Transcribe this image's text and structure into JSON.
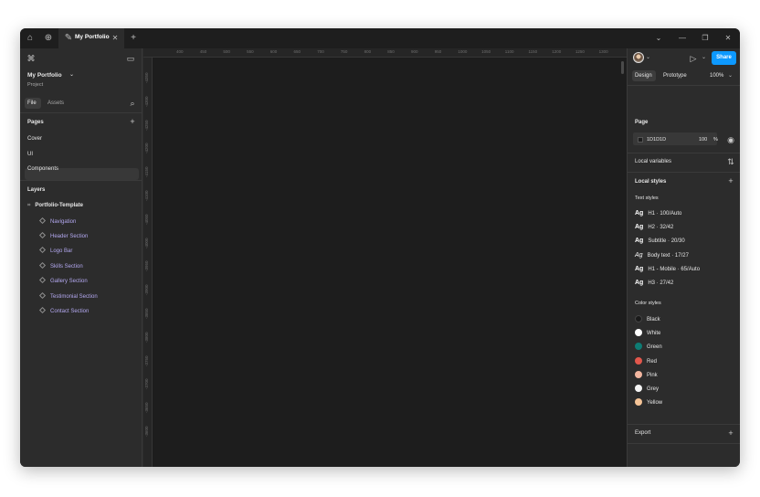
{
  "titlebar": {
    "tab_title": "My Portfolio",
    "icons": [
      "home-icon",
      "globe-icon",
      "file-icon",
      "close-icon",
      "plus-icon"
    ]
  },
  "left": {
    "file_name": "My Portfolio",
    "file_subtitle": "Project",
    "tabs": [
      "File",
      "Assets"
    ],
    "pages_heading": "Pages",
    "pages": [
      "Cover",
      "UI",
      "Components"
    ],
    "layers_heading": "Layers",
    "root_layer": "Portfolio-Template",
    "layers": [
      "Navigation",
      "Header Section",
      "Logo Bar",
      "Skills Section",
      "Gallery Section",
      "Testimonial Section",
      "Contact Section"
    ]
  },
  "ruler": {
    "top": [
      "400",
      "450",
      "500",
      "550",
      "600",
      "650",
      "700",
      "750",
      "800",
      "850",
      "900",
      "950",
      "1000",
      "1050",
      "1100",
      "1150",
      "1200",
      "1250",
      "1300"
    ],
    "left": [
      "-4350",
      "-4300",
      "-4250",
      "-4200",
      "-4150",
      "-4100",
      "-4050",
      "-4000",
      "-3950",
      "-3900",
      "-3850",
      "-3800",
      "-3750",
      "-3700",
      "-3650",
      "-3600"
    ]
  },
  "right": {
    "share_label": "Share",
    "tabs": [
      "Design",
      "Prototype"
    ],
    "zoom": "100%",
    "page_heading": "Page",
    "page_color": "1D1D1D",
    "page_opacity": "100",
    "percent": "%",
    "local_variables": "Local variables",
    "local_styles": "Local styles",
    "text_styles_heading": "Text styles",
    "ag": "Ag",
    "text_styles": [
      "H1 · 100/Auto",
      "H2 · 32/42",
      "Subtitle · 20/30",
      "Body text · 17/27",
      "H1 - Mobile · 65/Auto",
      "H3 · 27/42"
    ],
    "color_styles_heading": "Color styles",
    "color_styles": [
      {
        "name": "Black",
        "color": "#1a1a1a"
      },
      {
        "name": "White",
        "color": "#ffffff"
      },
      {
        "name": "Green",
        "color": "#0e7c74"
      },
      {
        "name": "Red",
        "color": "#e2574c"
      },
      {
        "name": "Pink",
        "color": "#f2b6a0"
      },
      {
        "name": "Grey",
        "color": "#f4f4f4"
      },
      {
        "name": "Yellow",
        "color": "#f5c497"
      }
    ],
    "export_heading": "Export",
    "accent": "#0d99ff"
  }
}
